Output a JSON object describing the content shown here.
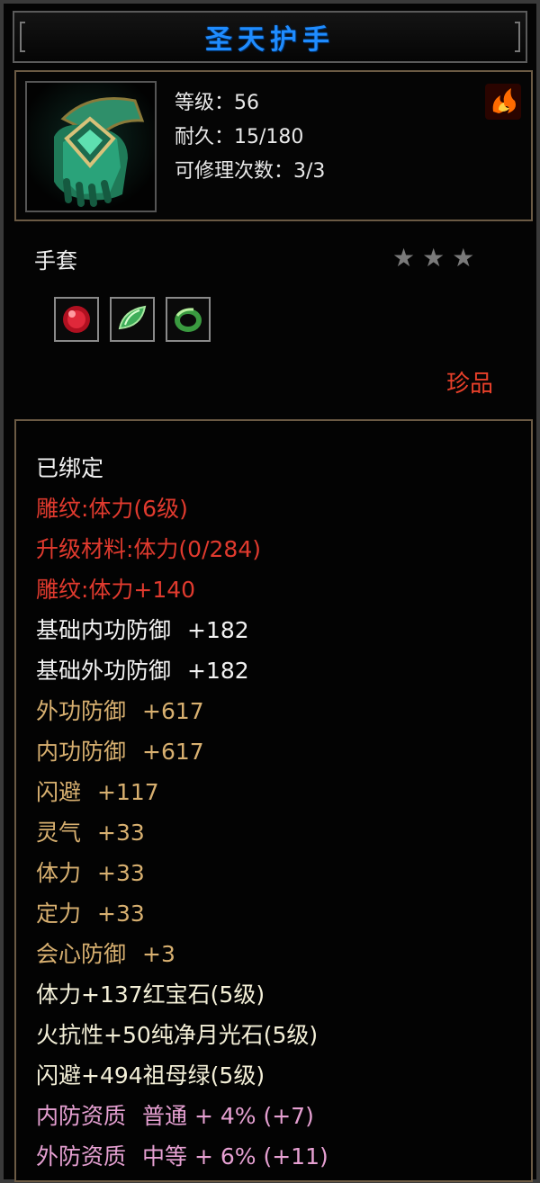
{
  "title": "圣天护手",
  "stats": {
    "level_label": "等级：",
    "level_value": "56",
    "durability_label": "耐久：",
    "durability_value": "15/180",
    "repair_label": "可修理次数：",
    "repair_value": "3/3"
  },
  "item_type": "手套",
  "stars": [
    "★",
    "★",
    "★"
  ],
  "gems": [
    "ruby-gem",
    "emerald-gem",
    "jade-ring-gem"
  ],
  "rarity": "珍品",
  "attributes": [
    {
      "name": "已绑定",
      "value": "",
      "color": "#f2f2f2"
    },
    {
      "name": "雕纹:体力(6级)",
      "value": "",
      "color": "#e03a2e"
    },
    {
      "name": "升级材料:体力(0/284)",
      "value": "",
      "color": "#e03a2e"
    },
    {
      "name": "雕纹:体力+140",
      "value": "",
      "color": "#e03a2e"
    },
    {
      "name": "基础内功防御",
      "value": "+182",
      "color": "#f2f2f2"
    },
    {
      "name": "基础外功防御",
      "value": "+182",
      "color": "#f2f2f2"
    },
    {
      "name": "外功防御",
      "value": "+617",
      "color": "#d8b070"
    },
    {
      "name": "内功防御",
      "value": "+617",
      "color": "#d8b070"
    },
    {
      "name": "闪避",
      "value": "+117",
      "color": "#d8b070"
    },
    {
      "name": "灵气",
      "value": "+33",
      "color": "#d8b070"
    },
    {
      "name": "体力",
      "value": "+33",
      "color": "#d8b070"
    },
    {
      "name": "定力",
      "value": "+33",
      "color": "#d8b070"
    },
    {
      "name": "会心防御",
      "value": "+3",
      "color": "#d8b070"
    },
    {
      "name": "体力+137红宝石(5级)",
      "value": "",
      "color": "#f4f0d8"
    },
    {
      "name": "火抗性+50纯净月光石(5级)",
      "value": "",
      "color": "#f4f0d8"
    },
    {
      "name": "闪避+494祖母绿(5级)",
      "value": "",
      "color": "#f4f0d8"
    },
    {
      "name": "内防资质",
      "value": "普通 + 4% (+7)",
      "color": "#e6a0d2"
    },
    {
      "name": "外防资质",
      "value": "中等 + 6% (+11)",
      "color": "#e6a0d2"
    }
  ]
}
